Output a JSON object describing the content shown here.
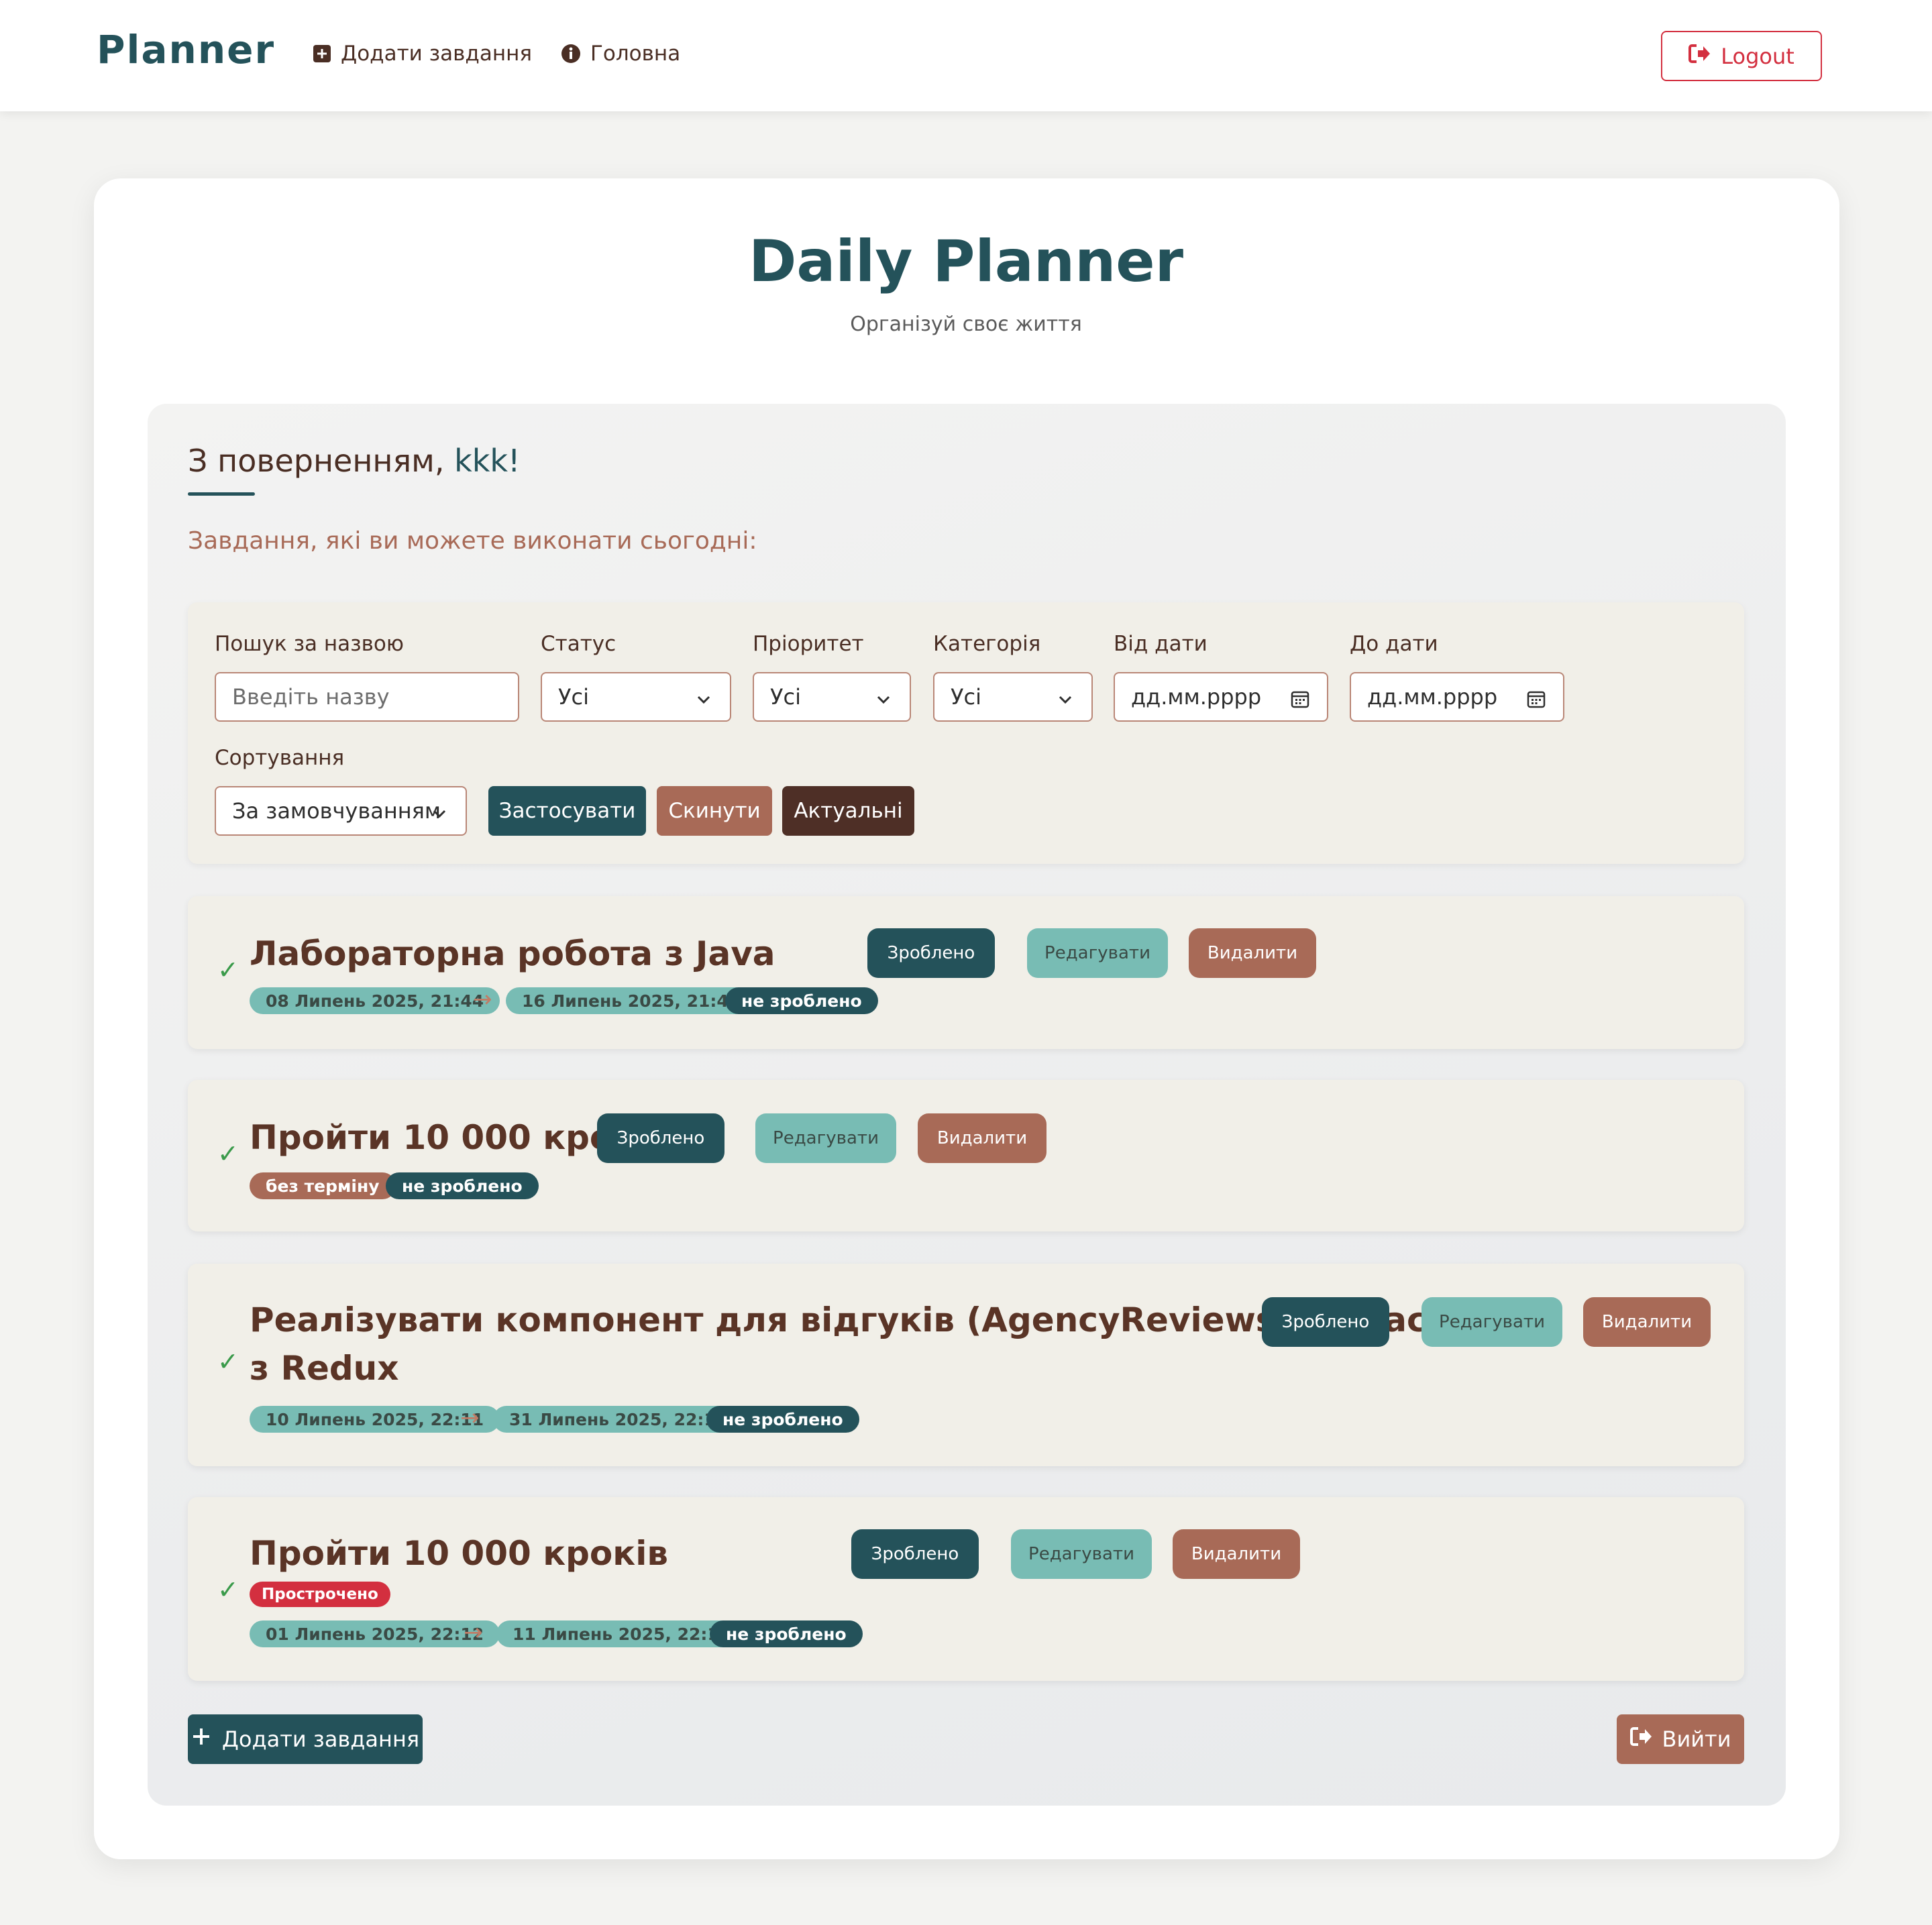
{
  "navbar": {
    "brand": "Planner",
    "links": [
      {
        "label": "Додати завдання",
        "icon": "plus-square-icon"
      },
      {
        "label": "Головна",
        "icon": "info-circle-icon"
      }
    ],
    "logout_label": "Logout"
  },
  "header": {
    "title": "Daily Planner",
    "subtitle": "Організуй своє життя"
  },
  "welcome": {
    "prefix": "З поверненням, ",
    "username": "kkk!",
    "today_text": "Завдання, які ви можете виконати сьогодні:"
  },
  "filters": {
    "search_label": "Пошук за назвою",
    "search_placeholder": "Введіть назву",
    "status_label": "Статус",
    "status_value": "Усі",
    "priority_label": "Пріоритет",
    "priority_value": "Усі",
    "category_label": "Категорія",
    "category_value": "Усі",
    "from_label": "Від дати",
    "from_placeholder": "дд.мм.рррр",
    "to_label": "До дати",
    "to_placeholder": "дд.мм.рррр",
    "sort_label": "Сортування",
    "sort_value": "За замовчуванням",
    "apply_label": "Застосувати",
    "reset_label": "Скинути",
    "actual_label": "Актуальні"
  },
  "task_buttons": {
    "done": "Зроблено",
    "edit": "Редагувати",
    "delete": "Видалити"
  },
  "tasks": [
    {
      "title": "Лабораторна робота з Java",
      "start": "08 Липень 2025, 21:44",
      "end": "16 Липень 2025, 21:44",
      "status": "не зроблено"
    },
    {
      "title": "Пройти 10 000 кроків",
      "deadline_badge": "без терміну",
      "status": "не зроблено"
    },
    {
      "title_line1": "Реалізувати компонент для відгуків (AgencyReviews) в React",
      "title_line2": "з Redux",
      "start": "10 Липень 2025, 22:11",
      "end": "31 Липень 2025, 22:11",
      "status": "не зроблено"
    },
    {
      "title": "Пройти 10 000 кроків",
      "overdue_badge": "Прострочено",
      "start": "01 Липень 2025, 22:12",
      "end": "11 Липень 2025, 22:12",
      "status": "не зроблено"
    }
  ],
  "check_mark": "✓",
  "arrow": "→",
  "footer": {
    "add_label": "Додати завдання",
    "exit_label": "Вийти"
  },
  "colors": {
    "primary": "#24525a",
    "brown": "#a86a57",
    "dark_brown": "#4e2f26",
    "teal": "#78bcb4",
    "danger": "#d32f3f"
  }
}
